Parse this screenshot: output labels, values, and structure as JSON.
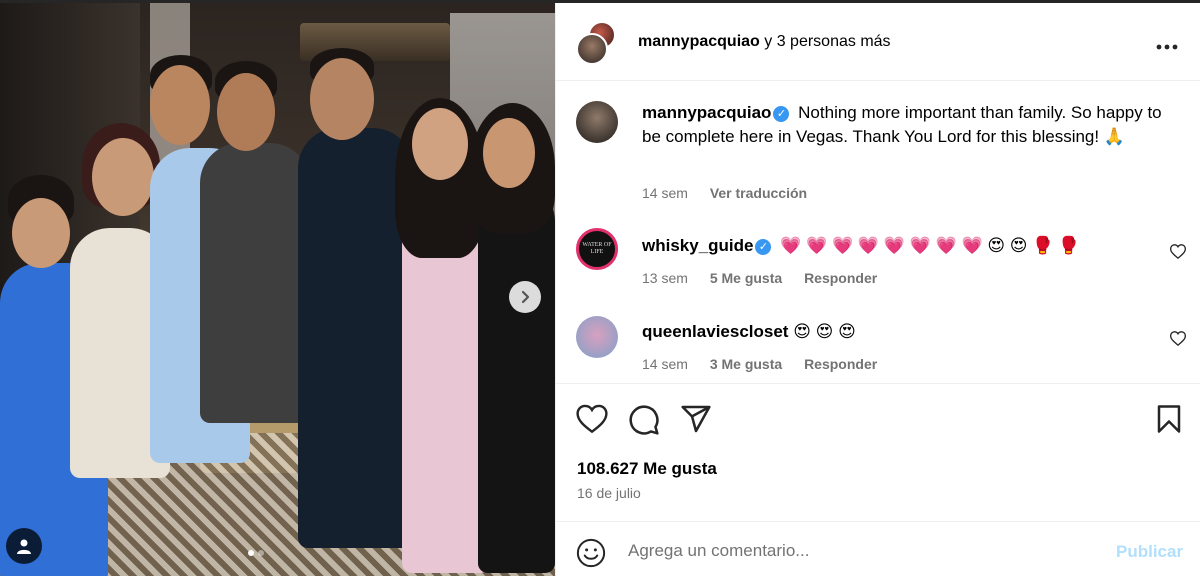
{
  "header": {
    "username": "mannypacquiao",
    "collab_text": "y 3 personas más",
    "more_icon": "more-horizontal-icon"
  },
  "caption": {
    "username": "mannypacquiao",
    "verified": true,
    "text": "Nothing more important than family. So happy to be complete here in Vegas. Thank You Lord for this blessing! 🙏",
    "time": "14 sem",
    "translate_label": "Ver traducción"
  },
  "comments": [
    {
      "username": "whisky_guide",
      "verified": true,
      "avatar_text": "WATER OF LIFE",
      "text": "💗 💗 💗 💗 💗 💗 💗 💗 😍 😍 🥊 🥊",
      "time": "13 sem",
      "likes": "5 Me gusta",
      "reply": "Responder"
    },
    {
      "username": "queenlaviescloset",
      "verified": false,
      "text": "😍 😍 😍",
      "time": "14 sem",
      "likes": "3 Me gusta",
      "reply": "Responder"
    }
  ],
  "actions": {
    "likes": "108.627 Me gusta",
    "date": "16 de julio"
  },
  "add_comment": {
    "emoji_icon": "emoji-smile-icon",
    "placeholder": "Agrega un comentario...",
    "publish_label": "Publicar"
  },
  "carousel": {
    "next_icon": "chevron-right-icon",
    "slides": 2,
    "current": 1
  },
  "colors": {
    "verified": "#3897f0",
    "publish_disabled": "#b2dffc",
    "meta_gray": "#737373"
  }
}
